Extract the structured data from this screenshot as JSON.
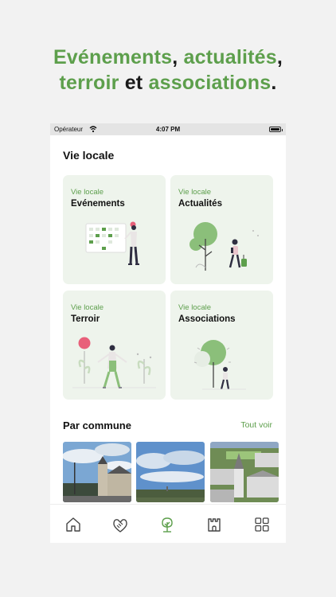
{
  "headline": {
    "line1_part1": "Evénements",
    "line1_sep": ",",
    "line1_part2": "actualités",
    "line1_end": ",",
    "line2_part1": "terroir",
    "line2_mid": "et",
    "line2_part2": "associations",
    "line2_end": "."
  },
  "status_bar": {
    "carrier": "Opérateur",
    "time": "4:07 PM"
  },
  "section": {
    "title": "Vie locale"
  },
  "cards": [
    {
      "kicker": "Vie locale",
      "title": "Evénements"
    },
    {
      "kicker": "Vie locale",
      "title": "Actualités"
    },
    {
      "kicker": "Vie locale",
      "title": "Terroir"
    },
    {
      "kicker": "Vie locale",
      "title": "Associations"
    }
  ],
  "communes": {
    "title": "Par commune",
    "see_all": "Tout voir"
  },
  "tabbar": {
    "icons": [
      "home-icon",
      "handshake-icon",
      "tree-icon",
      "castle-icon",
      "grid-icon"
    ],
    "active_index": 2
  },
  "colors": {
    "accent": "#5d9f4c",
    "card_bg": "#eef4ec",
    "pink": "#e8607a"
  }
}
